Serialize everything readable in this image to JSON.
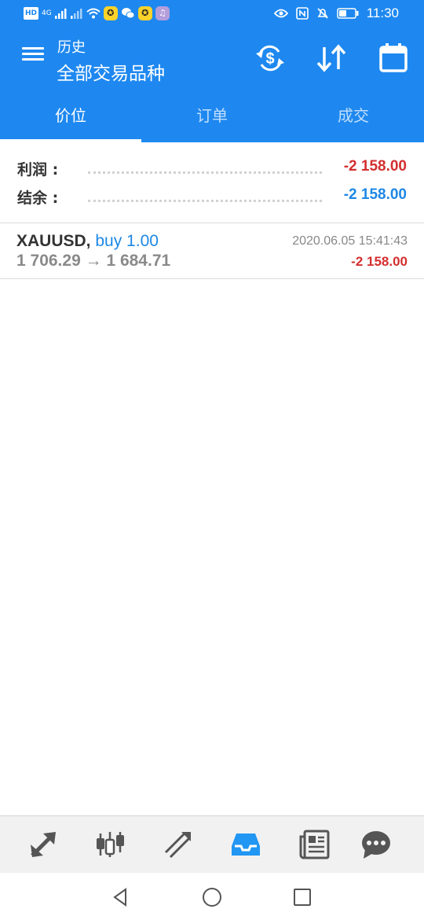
{
  "status_bar": {
    "left_chips": [
      "HD",
      "4G"
    ],
    "time": "11:30",
    "icons": [
      "wifi-icon",
      "eye-icon",
      "nfc-icon",
      "mute-icon",
      "battery-icon"
    ]
  },
  "toolbar": {
    "subtitle": "历史",
    "title": "全部交易品种",
    "icons": [
      "dollar-refresh-icon",
      "sort-icon",
      "calendar-icon"
    ]
  },
  "tabs": [
    {
      "label": "价位",
      "active": true
    },
    {
      "label": "订单",
      "active": false
    },
    {
      "label": "成交",
      "active": false
    }
  ],
  "summary": {
    "profit_label": "利润 :",
    "profit_value": "-2 158.00",
    "balance_label": "结余 :",
    "balance_value": "-2 158.00"
  },
  "trades": [
    {
      "symbol": "XAUUSD,",
      "side": "buy 1.00",
      "open_price": "1 706.29",
      "arrow": "→",
      "close_price": "1 684.71",
      "time": "2020.06.05 15:41:43",
      "profit": "-2 158.00"
    }
  ],
  "bottom_nav": {
    "items": [
      "quotes-icon",
      "chart-icon",
      "trade-icon",
      "history-icon",
      "news-icon",
      "chat-icon"
    ],
    "active": "history-icon"
  },
  "colors": {
    "header_bg": "#1e88f0",
    "negative": "#d32f2f",
    "positive_blue": "#1e88e5",
    "nav_active": "#2196f3",
    "nav_inactive": "#555555"
  }
}
